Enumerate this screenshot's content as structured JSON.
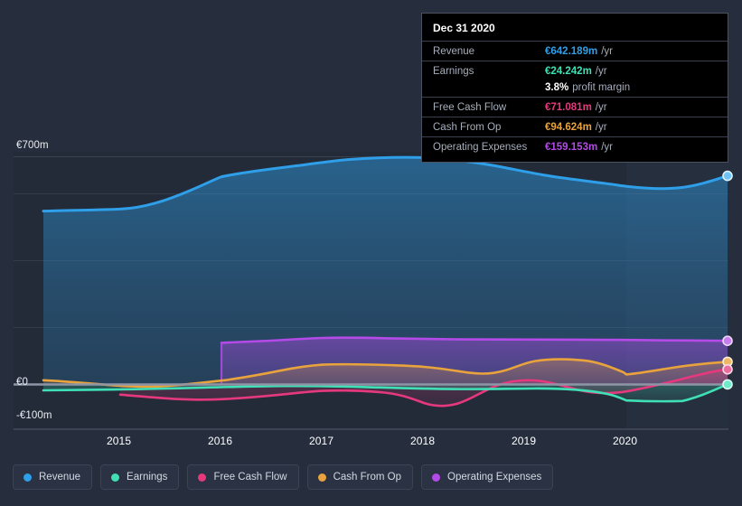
{
  "chart_data": {
    "type": "area",
    "title": "",
    "xlabel": "",
    "ylabel": "",
    "currency": "EUR",
    "unit": "m",
    "ylim": [
      -100,
      700
    ],
    "y_ticks": [
      {
        "label": "€700m",
        "value": 700
      },
      {
        "label": "€0",
        "value": 0
      },
      {
        "label": "-€100m",
        "value": -100
      }
    ],
    "gridlines_values": [
      700,
      600,
      420,
      240,
      0,
      -100
    ],
    "x_ticks": [
      "2015",
      "2016",
      "2017",
      "2018",
      "2019",
      "2020"
    ],
    "x_range": [
      "2014-06",
      "2021-06"
    ],
    "grid": true,
    "legend_position": "bottom",
    "forecast_band_start": "2020",
    "series": [
      {
        "name": "Revenue",
        "color": "#2e9fe8",
        "x": [
          "2014.6",
          "2015.0",
          "2015.5",
          "2016.0",
          "2016.5",
          "2017.0",
          "2017.5",
          "2018.0",
          "2018.5",
          "2019.0",
          "2019.5",
          "2020.0",
          "2020.5",
          "2021.0"
        ],
        "values": [
          471,
          472,
          505,
          588,
          619,
          639,
          651,
          654,
          640,
          625,
          618,
          608,
          615,
          642
        ]
      },
      {
        "name": "Earnings",
        "color": "#3fe0b6",
        "x": [
          "2014.6",
          "2015.0",
          "2015.5",
          "2016.0",
          "2016.5",
          "2017.0",
          "2017.5",
          "2018.0",
          "2018.5",
          "2019.0",
          "2019.5",
          "2020.0",
          "2020.5",
          "2021.0"
        ],
        "values": [
          -11,
          -11,
          -10,
          -9,
          -7,
          -6,
          -8,
          -9,
          -9,
          -6,
          -13,
          -26,
          -26,
          24
        ]
      },
      {
        "name": "Free Cash Flow",
        "color": "#e6397d",
        "x": [
          "2015.0",
          "2015.5",
          "2016.0",
          "2016.5",
          "2017.0",
          "2017.5",
          "2018.0",
          "2018.5",
          "2019.0",
          "2019.5",
          "2020.0",
          "2020.5",
          "2021.0"
        ],
        "values": [
          -17,
          -26,
          -29,
          -26,
          -22,
          -21,
          -24,
          -39,
          -8,
          4,
          -16,
          22,
          71
        ]
      },
      {
        "name": "Cash From Op",
        "color": "#e8a33d",
        "x": [
          "2014.6",
          "2015.0",
          "2015.5",
          "2016.0",
          "2016.5",
          "2017.0",
          "2017.5",
          "2018.0",
          "2018.5",
          "2019.0",
          "2019.5",
          "2020.0",
          "2020.5",
          "2021.0"
        ],
        "values": [
          11,
          7,
          -3,
          2,
          32,
          58,
          57,
          55,
          39,
          71,
          73,
          28,
          44,
          95
        ]
      },
      {
        "name": "Operating Expenses",
        "color": "#b44ae8",
        "x": [
          "2016.0",
          "2016.5",
          "2017.0",
          "2017.5",
          "2018.0",
          "2018.5",
          "2019.0",
          "2019.5",
          "2020.0",
          "2020.5",
          "2021.0"
        ],
        "values": [
          152,
          155,
          162,
          165,
          163,
          161,
          160,
          160,
          160,
          159,
          159
        ]
      }
    ]
  },
  "tooltip": {
    "date": "Dec 31 2020",
    "rows": [
      {
        "key": "Revenue",
        "value": "€642.189m",
        "unit": "/yr",
        "color": "#2e9fe8"
      },
      {
        "key": "Earnings",
        "value": "€24.242m",
        "unit": "/yr",
        "color": "#3fe0b6"
      },
      {
        "key": "Free Cash Flow",
        "value": "€71.081m",
        "unit": "/yr",
        "color": "#e6397d"
      },
      {
        "key": "Cash From Op",
        "value": "€94.624m",
        "unit": "/yr",
        "color": "#e8a33d"
      },
      {
        "key": "Operating Expenses",
        "value": "€159.153m",
        "unit": "/yr",
        "color": "#b44ae8"
      }
    ],
    "profit_margin_value": "3.8%",
    "profit_margin_label": "profit margin"
  },
  "legend": {
    "items": [
      {
        "label": "Revenue",
        "color": "#2e9fe8"
      },
      {
        "label": "Earnings",
        "color": "#3fe0b6"
      },
      {
        "label": "Free Cash Flow",
        "color": "#e6397d"
      },
      {
        "label": "Cash From Op",
        "color": "#e8a33d"
      },
      {
        "label": "Operating Expenses",
        "color": "#b44ae8"
      }
    ]
  },
  "axis": {
    "y_top_label": "€700m",
    "y_zero_label": "€0",
    "y_bottom_label": "-€100m",
    "x_labels": [
      "2015",
      "2016",
      "2017",
      "2018",
      "2019",
      "2020"
    ]
  },
  "colors": {
    "background": "#262e3d",
    "plot_background": "#222a38",
    "gridline": "#39404f",
    "zero_line": "#8e96a6"
  }
}
